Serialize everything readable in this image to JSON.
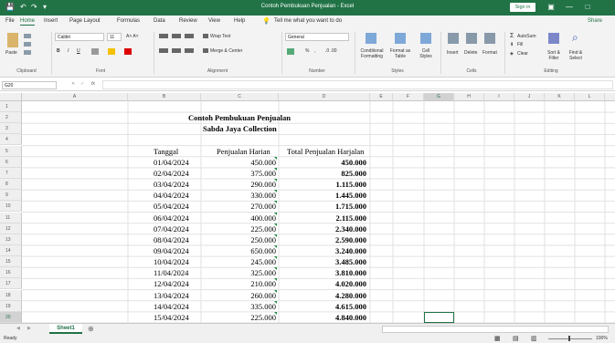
{
  "titlebar": {
    "doc_title": "Contoh Pembukuan Penjualan - Excel",
    "sign_in": "Sign in",
    "qa_save": "💾",
    "qa_undo": "↶",
    "qa_redo": "↷",
    "qa_more": "▾",
    "btn_display": "▣",
    "btn_min": "—",
    "btn_restore": "□"
  },
  "tabs": [
    "File",
    "Home",
    "Insert",
    "Page Layout",
    "Formulas",
    "Data",
    "Review",
    "View",
    "Help"
  ],
  "tell_me": "Tell me what you want to do",
  "share": "Share",
  "ribbon": {
    "paste": "Paste",
    "font_name": "Calibri",
    "font_size": "11",
    "bold": "B",
    "italic": "I",
    "underline": "U",
    "wrap_text": "Wrap Text",
    "merge_center": "Merge & Center",
    "number_format": "General",
    "percent": "%",
    "comma": ",",
    "conditional_formatting": "Conditional Formatting",
    "format_as_table": "Format as Table",
    "cell_styles": "Cell Styles",
    "insert": "Insert",
    "delete": "Delete",
    "format": "Format",
    "autosum": "AutoSum",
    "fill": "Fill",
    "clear": "Clear",
    "sort_filter": "Sort & Filter",
    "find_select": "Find & Select",
    "groups": [
      "Clipboard",
      "Font",
      "Alignment",
      "Number",
      "Styles",
      "Cells",
      "Editing"
    ]
  },
  "formula_bar": {
    "name_box": "G20",
    "fx": "fx",
    "value": ""
  },
  "columns": [
    "A",
    "B",
    "C",
    "D",
    "E",
    "F",
    "G",
    "H",
    "I",
    "J",
    "K",
    "L",
    "M"
  ],
  "rows": [
    "1",
    "2",
    "3",
    "4",
    "5",
    "6",
    "7",
    "8",
    "9",
    "10",
    "11",
    "12",
    "13",
    "14",
    "15",
    "16",
    "17",
    "18",
    "19",
    "20"
  ],
  "sheet": {
    "title1": "Contoh Pembukuan Penjualan",
    "title2": "Sabda Jaya Collection",
    "headers": [
      "Tanggal",
      "Penjualan Harian",
      "Total Penjualan Harjalan"
    ],
    "data": [
      [
        "01/04/2024",
        "450.000",
        "450.000"
      ],
      [
        "02/04/2024",
        "375.000",
        "825.000"
      ],
      [
        "03/04/2024",
        "290.000",
        "1.115.000"
      ],
      [
        "04/04/2024",
        "330.000",
        "1.445.000"
      ],
      [
        "05/04/2024",
        "270.000",
        "1.715.000"
      ],
      [
        "06/04/2024",
        "400.000",
        "2.115.000"
      ],
      [
        "07/04/2024",
        "225.000",
        "2.340.000"
      ],
      [
        "08/04/2024",
        "250.000",
        "2.590.000"
      ],
      [
        "09/04/2024",
        "650.000",
        "3.240.000"
      ],
      [
        "10/04/2024",
        "245.000",
        "3.485.000"
      ],
      [
        "11/04/2024",
        "325.000",
        "3.810.000"
      ],
      [
        "12/04/2024",
        "210.000",
        "4.020.000"
      ],
      [
        "13/04/2024",
        "260.000",
        "4.280.000"
      ],
      [
        "14/04/2024",
        "335.000",
        "4.615.000"
      ],
      [
        "15/04/2024",
        "225.000",
        "4.840.000"
      ]
    ]
  },
  "sheet_tabs": {
    "active": "Sheet1",
    "add": "⊕"
  },
  "status": {
    "ready": "Ready",
    "zoom": "100%"
  },
  "colors": {
    "accent": "#217346",
    "ribbon_bg": "#f3f3f3",
    "selection": "#217346"
  }
}
